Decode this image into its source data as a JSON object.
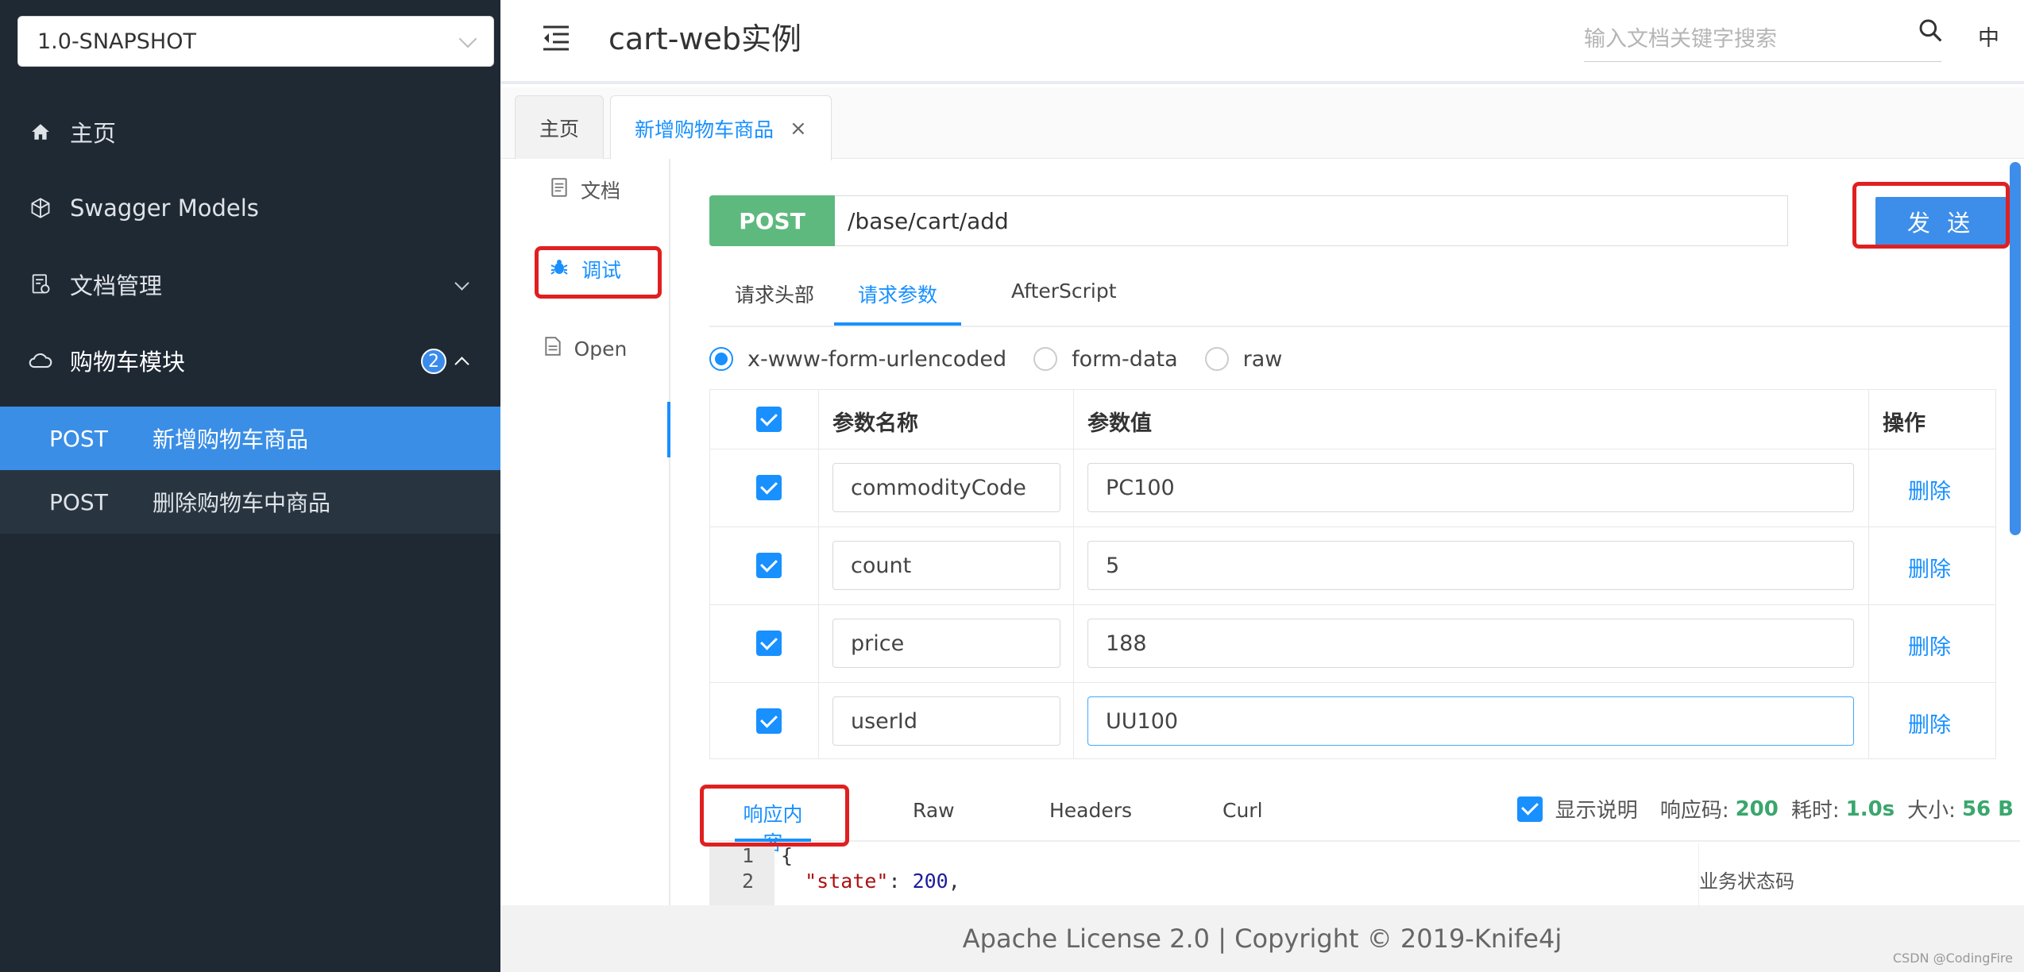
{
  "sidebar": {
    "version": "1.0-SNAPSHOT",
    "menu": [
      {
        "label": "主页"
      },
      {
        "label": "Swagger Models"
      },
      {
        "label": "文档管理"
      },
      {
        "label": "购物车模块",
        "badge": "2"
      }
    ],
    "sub_items": [
      {
        "method": "POST",
        "label": "新增购物车商品"
      },
      {
        "method": "POST",
        "label": "删除购物车中商品"
      }
    ]
  },
  "header": {
    "title": "cart-web实例",
    "search_placeholder": "输入文档关键字搜索",
    "lang": "中"
  },
  "tabs": [
    {
      "label": "主页"
    },
    {
      "label": "新增购物车商品",
      "close": "×"
    }
  ],
  "mininav": [
    {
      "label": "文档"
    },
    {
      "label": "调试"
    },
    {
      "label": "Open"
    }
  ],
  "request": {
    "method": "POST",
    "url": "/base/cart/add",
    "send_label": "发 送"
  },
  "req_tabs": [
    "请求头部",
    "请求参数",
    "AfterScript"
  ],
  "content_types": [
    "x-www-form-urlencoded",
    "form-data",
    "raw"
  ],
  "params_table": {
    "headers": [
      "参数名称",
      "参数值",
      "操作"
    ],
    "rows": [
      {
        "name": "commodityCode",
        "value": "PC100",
        "action": "删除"
      },
      {
        "name": "count",
        "value": "5",
        "action": "删除"
      },
      {
        "name": "price",
        "value": "188",
        "action": "删除"
      },
      {
        "name": "userId",
        "value": "UU100",
        "action": "删除"
      }
    ]
  },
  "response": {
    "tabs": [
      "响应内容",
      "Raw",
      "Headers",
      "Curl"
    ],
    "show_desc": "显示说明",
    "code_label": "响应码:",
    "code": "200",
    "time_label": "耗时:",
    "time": "1.0s",
    "size_label": "大小:",
    "size": "56 B",
    "gutter": [
      "1",
      "2"
    ],
    "line1": "{",
    "line2_key": "\"state\"",
    "line2_val": "200",
    "desc": "业务状态码"
  },
  "footer": "Apache License 2.0 | Copyright © 2019-Knife4j",
  "watermark": "CSDN @CodingFire",
  "colors": {
    "sidebar_bg": "#1f2934",
    "active_blue": "#3a8ee6",
    "post_green": "#5eb97e",
    "highlight_red": "#e02020"
  }
}
